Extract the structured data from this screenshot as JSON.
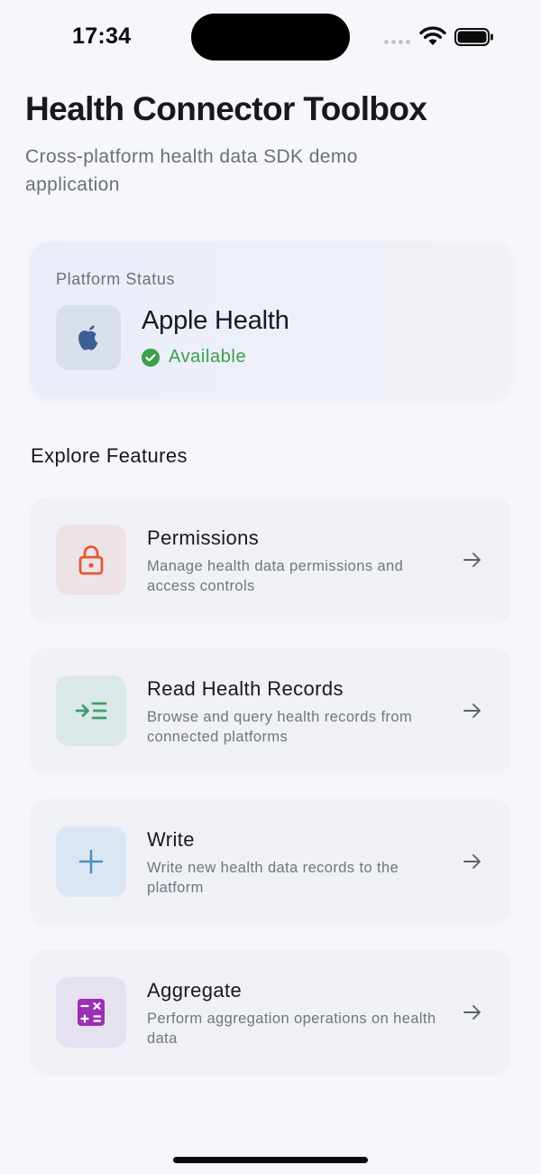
{
  "status_bar": {
    "time": "17:34"
  },
  "header": {
    "title": "Health Connector Toolbox",
    "subtitle": "Cross-platform health data SDK demo application"
  },
  "platform_card": {
    "label": "Platform Status",
    "name": "Apple Health",
    "status": "Available",
    "icon": "apple-icon"
  },
  "features": {
    "heading": "Explore Features",
    "items": [
      {
        "title": "Permissions",
        "description": "Manage health data permissions and access controls",
        "icon": "lock-icon",
        "icon_color": "#e35a2f",
        "icon_bg": "#ede3e7"
      },
      {
        "title": "Read Health Records",
        "description": "Browse and query health records from connected platforms",
        "icon": "list-import-icon",
        "icon_color": "#3f9e6a",
        "icon_bg": "#dae8ea"
      },
      {
        "title": "Write",
        "description": "Write new health data records to the platform",
        "icon": "plus-icon",
        "icon_color": "#4f8fbf",
        "icon_bg": "#dbe6f4"
      },
      {
        "title": "Aggregate",
        "description": "Perform aggregation operations on health data",
        "icon": "calculator-icon",
        "icon_color": "#9b2fb5",
        "icon_bg": "#e5e1ee"
      }
    ]
  },
  "colors": {
    "background": "#f6f7fb",
    "available_green": "#3aa04b",
    "text_primary": "#17191e",
    "text_secondary": "#6b6f78"
  }
}
